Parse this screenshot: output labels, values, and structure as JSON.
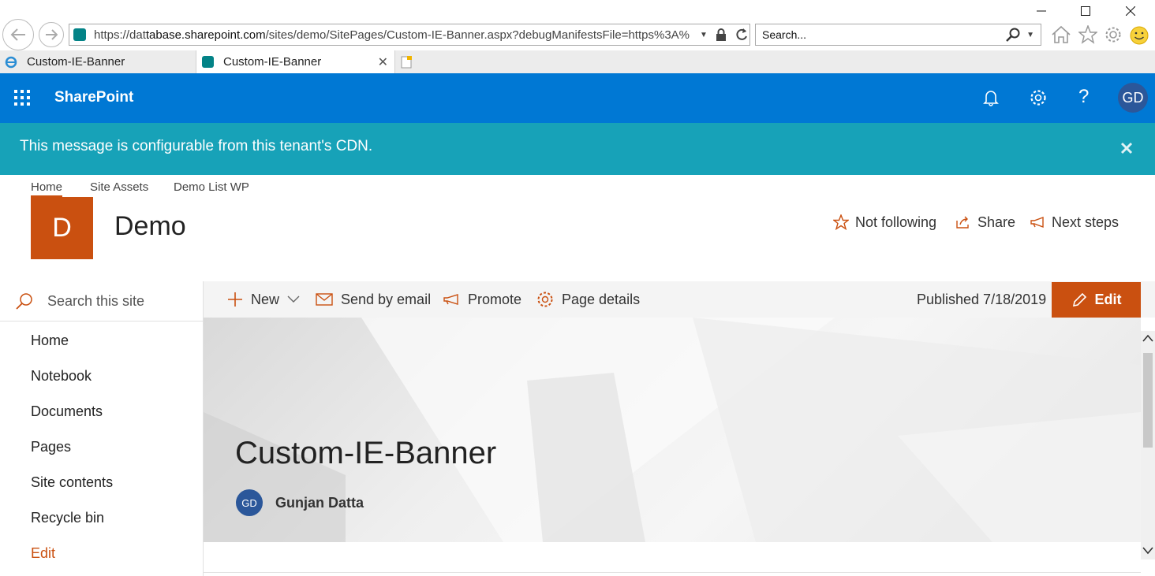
{
  "browser": {
    "url_prefix": "https://dat",
    "url_host": "tabase.sharepoint.com",
    "url_path": "/sites/demo/SitePages/Custom-IE-Banner.aspx?debugManifestsFile=https%3A%",
    "search_placeholder": "Search...",
    "tabs": [
      {
        "label": "Custom-IE-Banner",
        "active": false
      },
      {
        "label": "Custom-IE-Banner",
        "active": true
      }
    ]
  },
  "suite": {
    "app_name": "SharePoint",
    "user_initials": "GD",
    "color": "#0078d4"
  },
  "banner": {
    "message": "This message is configurable from this tenant's CDN.",
    "color": "#17a2b8"
  },
  "site": {
    "top_links": [
      "Home",
      "Site Assets",
      "Demo List WP"
    ],
    "logo_letter": "D",
    "title": "Demo",
    "actions": {
      "follow": "Not following",
      "share": "Share",
      "next_steps": "Next steps"
    },
    "accent": "#ca5010"
  },
  "leftnav": {
    "search_placeholder": "Search this site",
    "items": [
      "Home",
      "Notebook",
      "Documents",
      "Pages",
      "Site contents",
      "Recycle bin"
    ],
    "edit_link": "Edit"
  },
  "commandbar": {
    "new": "New",
    "send_email": "Send by email",
    "promote": "Promote",
    "page_details": "Page details",
    "published": "Published 7/18/2019",
    "edit": "Edit"
  },
  "page": {
    "title": "Custom-IE-Banner",
    "author_initials": "GD",
    "author": "Gunjan Datta"
  }
}
